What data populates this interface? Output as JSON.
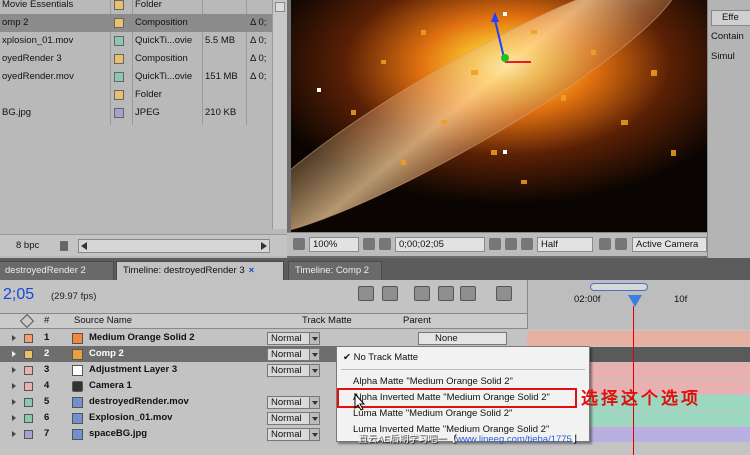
{
  "project": {
    "rows": [
      {
        "name": "Movie Essentials",
        "swatch": "#e8c070",
        "type": "Folder",
        "size": "",
        "dur": ""
      },
      {
        "name": "omp 2",
        "swatch": "#e8c070",
        "type": "Composition",
        "size": "",
        "dur": "Δ 0;"
      },
      {
        "name": "xplosion_01.mov",
        "swatch": "#8cc8b0",
        "type": "QuickTi...ovie",
        "size": "5.5 MB",
        "dur": "Δ 0;"
      },
      {
        "name": "oyedRender 3",
        "swatch": "#e8c070",
        "type": "Composition",
        "size": "",
        "dur": "Δ 0;"
      },
      {
        "name": "oyedRender.mov",
        "swatch": "#8cc8b0",
        "type": "QuickTi...ovie",
        "size": "151 MB",
        "dur": "Δ 0;"
      },
      {
        "name": "",
        "swatch": "#e8c070",
        "type": "Folder",
        "size": "",
        "dur": ""
      },
      {
        "name": "BG.jpg",
        "swatch": "#a8a0d0",
        "type": "JPEG",
        "size": "210 KB",
        "dur": ""
      }
    ],
    "bpc": "8 bpc"
  },
  "viewer": {
    "zoom": "100%",
    "timecode": "0;00;02;05",
    "resolution": "Half",
    "camera": "Active Camera"
  },
  "effects": {
    "tab": "Effe",
    "contain": "Contain",
    "simul": "Simul"
  },
  "tabs": {
    "render2": "destroyedRender 2",
    "active": "Timeline: destroyedRender 3",
    "close": "×",
    "comp2": "Timeline: Comp 2"
  },
  "timeline": {
    "timecode": "2;05",
    "fps": "(29.97 fps)",
    "ruler": {
      "t1": "02:00f",
      "t2": "10f"
    },
    "headers": {
      "source_name": "Source Name",
      "track_matte": "Track Matte",
      "parent": "Parent"
    },
    "parent_value": "None",
    "layers": [
      {
        "num": "1",
        "name": "Medium Orange Solid 2",
        "mode": "Normal",
        "color": "#f0a070",
        "icon": "#f08840",
        "bar": "#e8b0a0"
      },
      {
        "num": "2",
        "name": "Comp 2",
        "mode": "Normal",
        "color": "#e8c070",
        "icon": "#e8a040",
        "bar": "#5a5a5a"
      },
      {
        "num": "3",
        "name": "Adjustment Layer 3",
        "mode": "Normal",
        "color": "#e8b0b0",
        "icon": "#ffffff",
        "bar": "#e8b0b0"
      },
      {
        "num": "4",
        "name": "Camera 1",
        "mode": "",
        "color": "#e8b0b0",
        "icon": "#333333",
        "bar": "#e8b0b0"
      },
      {
        "num": "5",
        "name": "destroyedRender.mov",
        "mode": "Normal",
        "color": "#8cc8b0",
        "icon": "#7090d0",
        "bar": "#9cd8c0"
      },
      {
        "num": "6",
        "name": "Explosion_01.mov",
        "mode": "Normal",
        "color": "#8cc8b0",
        "icon": "#7090d0",
        "bar": "#9cd8c0"
      },
      {
        "num": "7",
        "name": "spaceBG.jpg",
        "mode": "Normal",
        "color": "#a8a0d0",
        "icon": "#7090d0",
        "bar": "#b8b0e0"
      }
    ]
  },
  "matte_menu": {
    "items": [
      "No Track Matte",
      "Alpha Matte \"Medium Orange Solid 2\"",
      "Alpha Inverted Matte \"Medium Orange Solid 2\"",
      "Luma Matte \"Medium Orange Solid 2\"",
      "Luma Inverted Matte \"Medium Orange Solid 2\""
    ]
  },
  "annotation": "选择这个选项",
  "watermark": {
    "cn": "直云AE后期学习吧一【",
    "url": "www.lineeg.com/tieba/1775",
    "end": "】"
  }
}
